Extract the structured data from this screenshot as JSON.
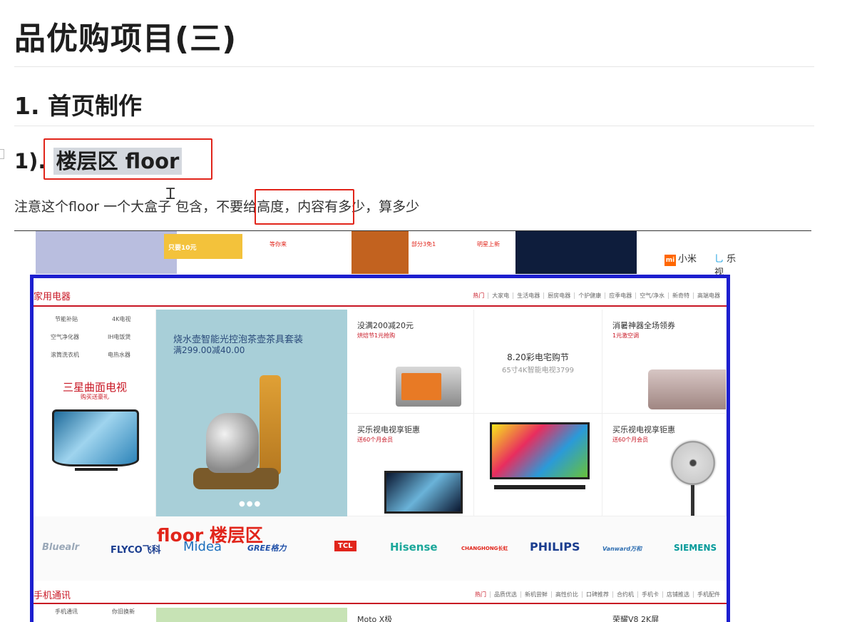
{
  "doc": {
    "title": "品优购项目(三)",
    "section": "1. 首页制作",
    "subsection_prefix": "1).",
    "subsection_highlight": "楼层区 floor",
    "note_a": "注意这个floor  一个大盒子 包含，",
    "note_b": "不要给高度，",
    "note_c": "内容有多少，算多少"
  },
  "screenshot": {
    "top_strip": {
      "card_text": "只要10元",
      "caption_1": "等你来",
      "caption_2": "部分3免1",
      "caption_3": "明星上新",
      "logo_mi": "小米",
      "logo_le": "乐视"
    },
    "floor1": {
      "title": "家用电器",
      "tabs": [
        "热门",
        "大家电",
        "生活电器",
        "厨房电器",
        "个护健康",
        "应季电器",
        "空气/净水",
        "新奇特",
        "高端电器"
      ],
      "links": [
        "节能补贴",
        "4K电视",
        "空气净化器",
        "IH电饭煲",
        "滚筒洗衣机",
        "电热水器"
      ],
      "promo_title": "三星曲面电视",
      "promo_sub": "购买送豪礼",
      "banner_title": "烧水壶智能光控泡茶壶茶具套装",
      "banner_sub": "满299.00减40.00",
      "carousel_dots": "●●●",
      "cells": [
        {
          "title": "没满200减20元",
          "sub": "烘焙节1元抢购"
        },
        {
          "title": "8.20彩电宅购节",
          "sub": "65寸4K智能电视3799"
        },
        {
          "title": "消暑神器全场领券",
          "sub": "1元激空调"
        },
        {
          "title": "买乐视电视享钜惠",
          "sub": "送60个月会员"
        },
        {
          "title": "买乐视电视享钜惠",
          "sub": "送60个月会员"
        }
      ],
      "brands": [
        "Bluealr",
        "FLYCO飞科",
        "Midea",
        "GREE格力",
        "TCL",
        "Hisense",
        "CHANGHONG长虹",
        "PHILIPS",
        "Vanward万和",
        "SIEMENS"
      ],
      "brand_colors": {
        "bluealr": "#9aa8b8",
        "flyco": "#1a3d8f",
        "midea": "#1b6fbd",
        "gree": "#2050a8",
        "tcl": "#e1251b",
        "hisense": "#1aa79a",
        "changhong": "#e1251b",
        "philips": "#1a3d8f",
        "vanward": "#2b6cb0",
        "siemens": "#009999"
      }
    },
    "floor_label": "floor 楼层区",
    "floor2": {
      "title": "手机通讯",
      "tabs": [
        "热门",
        "品质优选",
        "新机尝鲜",
        "高性价比",
        "口碑推荐",
        "合约机",
        "手机卡",
        "店铺推选",
        "手机配件"
      ],
      "links": [
        "手机通讯",
        "你旧换新"
      ],
      "cells": [
        {
          "title": "Moto X极"
        },
        {
          "title": "荣耀V8 2K屏"
        }
      ]
    }
  },
  "colors": {
    "accent_red": "#e1251b",
    "floor_red": "#c81623",
    "blue_border": "#1d1fcf",
    "highlight_bg": "#d4d8de"
  }
}
